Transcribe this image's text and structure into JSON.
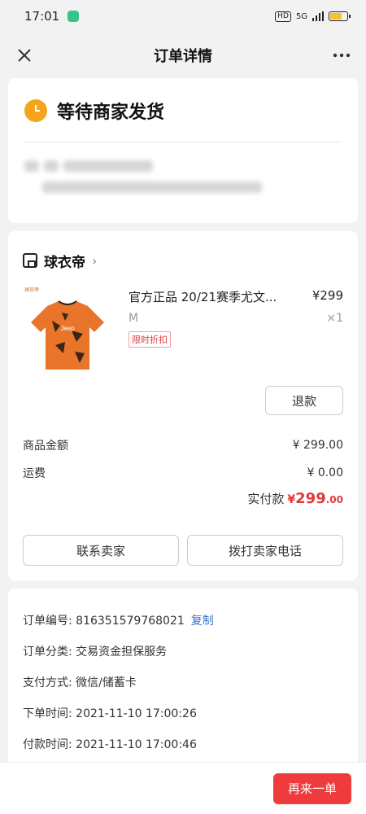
{
  "statusbar": {
    "time": "17:01",
    "network": "5G",
    "hd": "HD"
  },
  "nav": {
    "title": "订单详情"
  },
  "order_status": {
    "text": "等待商家发货"
  },
  "shop": {
    "name": "球衣帝"
  },
  "product": {
    "name": "官方正品 20/21赛季尤文...",
    "price": "¥299",
    "spec": "M",
    "qty": "×1",
    "tag": "限时折扣",
    "thumb_label": "球衣帝",
    "jersey_text": "Jeep"
  },
  "actions": {
    "refund": "退款",
    "contact": "联系卖家",
    "call": "拨打卖家电话",
    "reorder": "再来一单"
  },
  "amounts": {
    "goods_label": "商品金额",
    "goods_value": "¥ 299.00",
    "shipping_label": "运费",
    "shipping_value": "¥ 0.00",
    "paid_label": "实付款",
    "paid_symbol": "¥",
    "paid_integer": "299",
    "paid_cents": ".00"
  },
  "info": {
    "order_no": "订单编号: 816351579768021",
    "copy": "复制",
    "category": "订单分类: 交易资金担保服务",
    "payment": "支付方式: 微信/储蓄卡",
    "created": "下单时间: 2021-11-10 17:00:26",
    "paid_time": "付款时间: 2021-11-10 17:00:46"
  },
  "colors": {
    "accent": "#ee3b3b",
    "status_icon": "#f4a51c",
    "link": "#3973c7"
  }
}
